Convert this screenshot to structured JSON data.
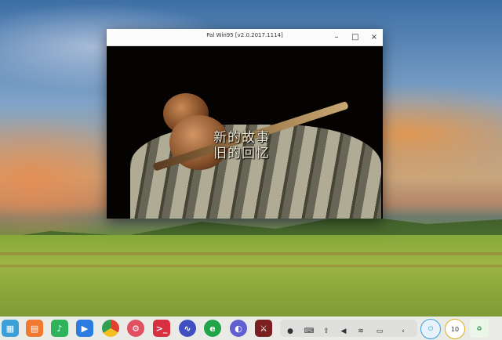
{
  "window": {
    "title": "Pal Win95 [v2.0.2017.1114]",
    "minimize_symbol": "–",
    "maximize_symbol": "□",
    "close_symbol": "×"
  },
  "game": {
    "line1": "新的故事",
    "line2": "旧的回忆"
  },
  "taskbar": {
    "apps": [
      {
        "name": "launcher-icon",
        "color": "#3ca0d8"
      },
      {
        "name": "app-store-icon",
        "color": "#f07830"
      },
      {
        "name": "music-icon",
        "color": "#2fb35a"
      },
      {
        "name": "video-icon",
        "color": "#2b7be0"
      },
      {
        "name": "chrome-icon",
        "color": "#e04030"
      },
      {
        "name": "settings-icon",
        "color": "#e05060"
      },
      {
        "name": "terminal-icon",
        "color": "#d83040"
      },
      {
        "name": "system-monitor-icon",
        "color": "#4050c0"
      },
      {
        "name": "edge-icon",
        "color": "#22a44a"
      },
      {
        "name": "browser-icon",
        "color": "#6060d0"
      },
      {
        "name": "game-icon",
        "color": "#7a2020"
      }
    ],
    "tray": {
      "clock_text": "10"
    },
    "colors": {
      "bar": "#f0f0f0",
      "accent": "#3aa0e0"
    }
  }
}
